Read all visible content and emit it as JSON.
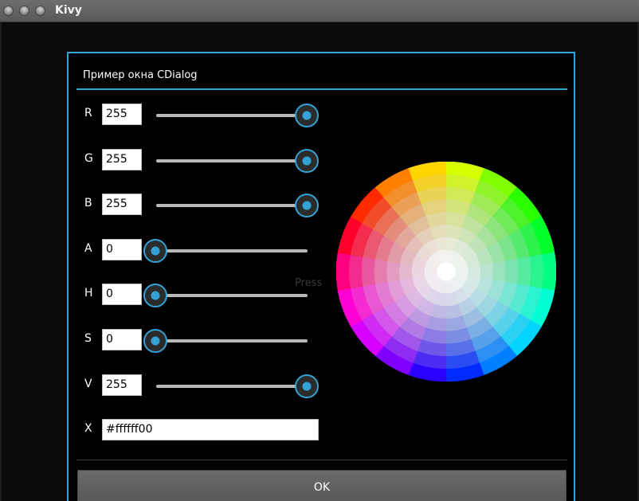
{
  "window": {
    "title": "Kivy",
    "buttons": [
      "close-icon",
      "minimize-icon",
      "maximize-icon"
    ]
  },
  "dialog": {
    "title": "Пример окна CDialog",
    "accent_color": "#33a3d6",
    "ghost_text": "Press",
    "ok_label": "OK"
  },
  "controls": [
    {
      "label": "R",
      "value": "255",
      "slider": 1.0
    },
    {
      "label": "G",
      "value": "255",
      "slider": 1.0
    },
    {
      "label": "B",
      "value": "255",
      "slider": 1.0
    },
    {
      "label": "A",
      "value": "0",
      "slider": 0.0
    },
    {
      "label": "H",
      "value": "0",
      "slider": 0.0
    },
    {
      "label": "S",
      "value": "0",
      "slider": 0.0
    },
    {
      "label": "V",
      "value": "255",
      "slider": 1.0
    }
  ],
  "hex": {
    "label": "X",
    "value": "#ffffff00"
  }
}
